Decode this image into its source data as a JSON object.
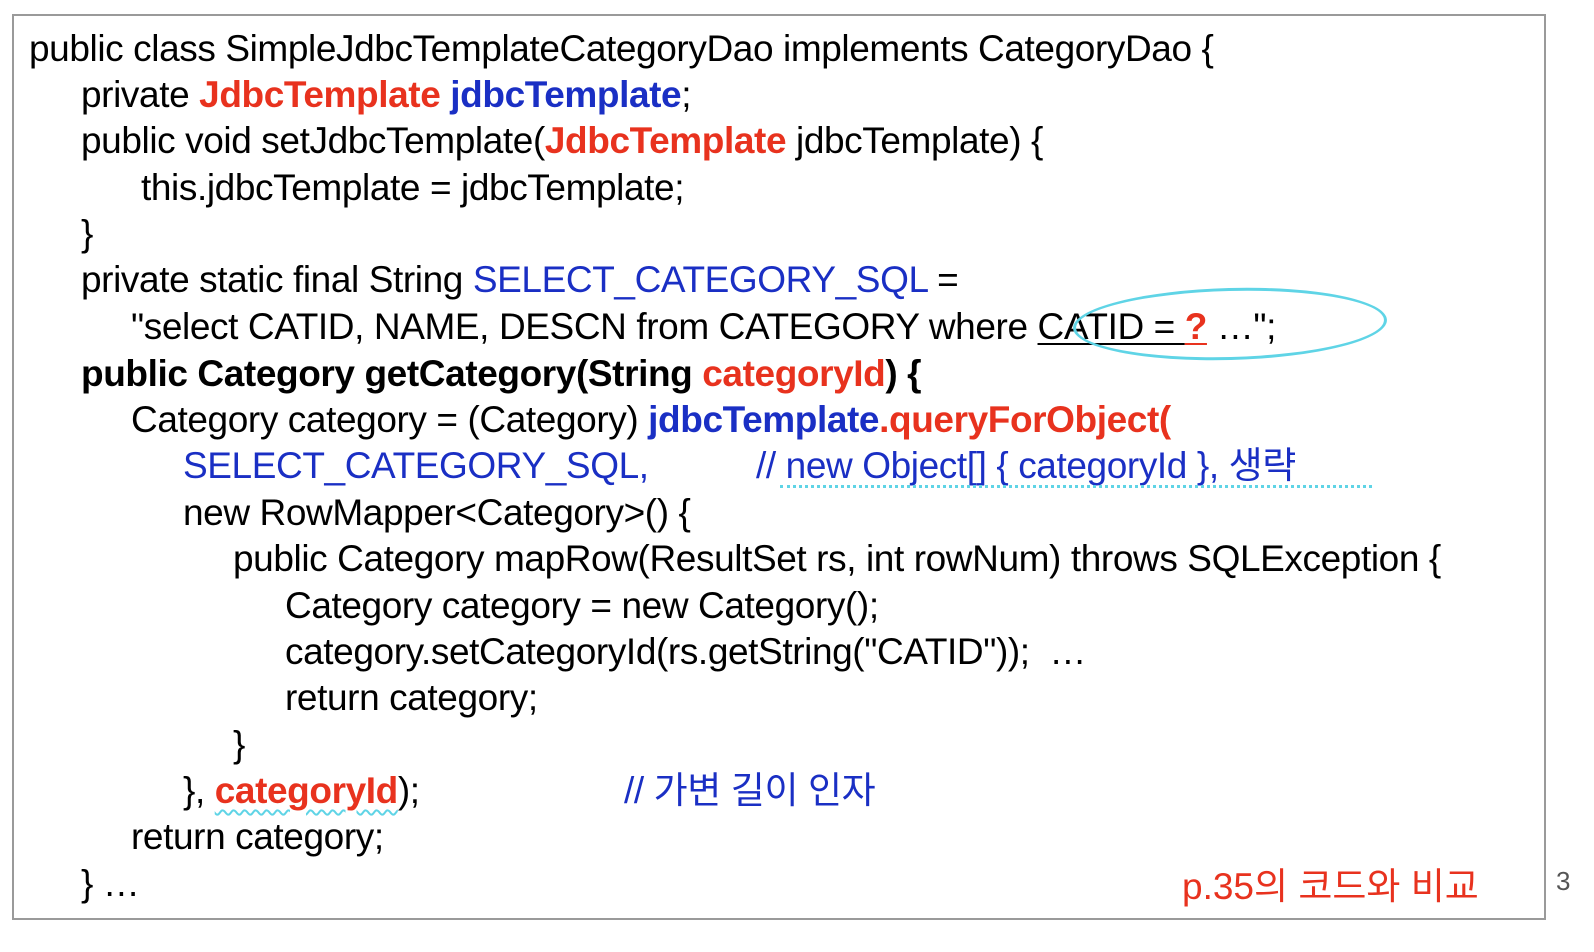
{
  "code": {
    "l1": "public class SimpleJdbcTemplateCategoryDao implements CategoryDao {",
    "l2_a": "private ",
    "l2_b": "JdbcTemplate",
    "l2_c": " ",
    "l2_d": "jdbcTemplate",
    "l2_e": ";",
    "l3_a": "public void setJdbcTemplate(",
    "l3_b": "JdbcTemplate",
    "l3_c": " jdbcTemplate) {",
    "l4": "this.jdbcTemplate = jdbcTemplate;",
    "l5": "}",
    "l6_a": "private static final String ",
    "l6_b": "SELECT_CATEGORY_SQL",
    "l6_c": " =",
    "l7_a": "\"select CATID, NAME, DESCN from CATEGORY where ",
    "l7_b": "CATID = ",
    "l7_c": "?",
    "l7_d": " …\";",
    "l8_a": "public Category getCategory(String ",
    "l8_b": "categoryId",
    "l8_c": ") {",
    "l9_a": "Category category = (Category) ",
    "l9_b": "jdbcTemplate",
    "l9_c": ".queryForObject(",
    "l10_a": "SELECT_CATEGORY_SQL,",
    "l10_b": "// new Object[] { categoryId }, 생략",
    "l11": "new RowMapper<Category>() {",
    "l12": "public Category mapRow(ResultSet rs, int rowNum) throws SQLException {",
    "l13": "Category category = new Category();",
    "l14": "category.setCategoryId(rs.getString(\"CATID\"));  …",
    "l15": "return category;",
    "l16": "}",
    "l17_a": "}, ",
    "l17_b": "categoryId",
    "l17_c": ");",
    "l17_d": "// 가변 길이 인자",
    "l18": "return category;",
    "l19": "} …"
  },
  "note": "p.35의 코드와 비교",
  "page_number": "3",
  "colors": {
    "red": "#e8321e",
    "blue": "#1a2fc4",
    "annotation": "#5fd4e6"
  }
}
